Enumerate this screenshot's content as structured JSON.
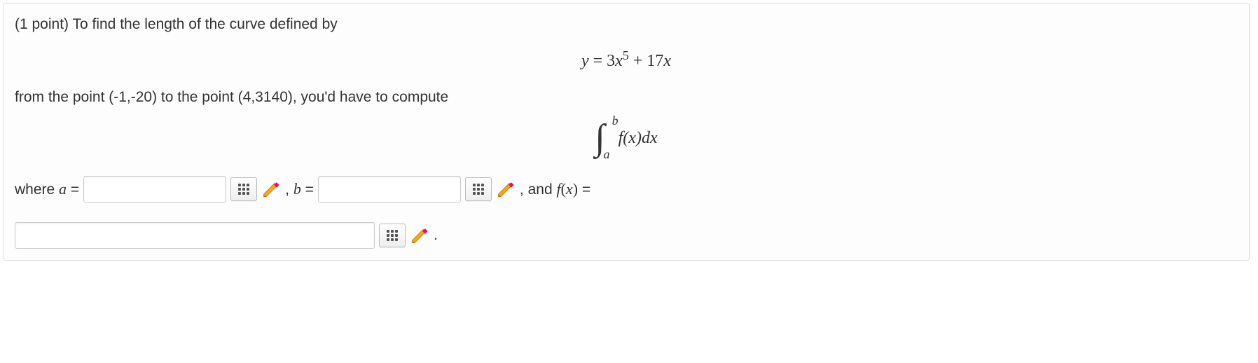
{
  "problem": {
    "lead": "(1 point) To find the length of the curve defined by",
    "equation": "y = 3x⁵ + 17x",
    "eq": {
      "lhs": "y",
      "eq_sign": "=",
      "coef1": "3",
      "var1": "x",
      "exp1": "5",
      "plus": " + ",
      "coef2": "17",
      "var2": "x"
    },
    "from_line": "from the point (-1,-20) to the point (4,3140), you'd have to compute",
    "integral": {
      "upper": "b",
      "lower": "a",
      "integrand": "f(x)dx"
    },
    "answers": {
      "where": "where ",
      "a_label": "a",
      "equals1": " = ",
      "comma_b": " , ",
      "b_label": "b",
      "equals2": " = ",
      "and_fx": " , and ",
      "fx_f": "f",
      "fx_paren": "(x)",
      "equals3": " = ",
      "period": " ."
    },
    "inputs": {
      "a_value": "",
      "b_value": "",
      "fx_value": ""
    }
  }
}
